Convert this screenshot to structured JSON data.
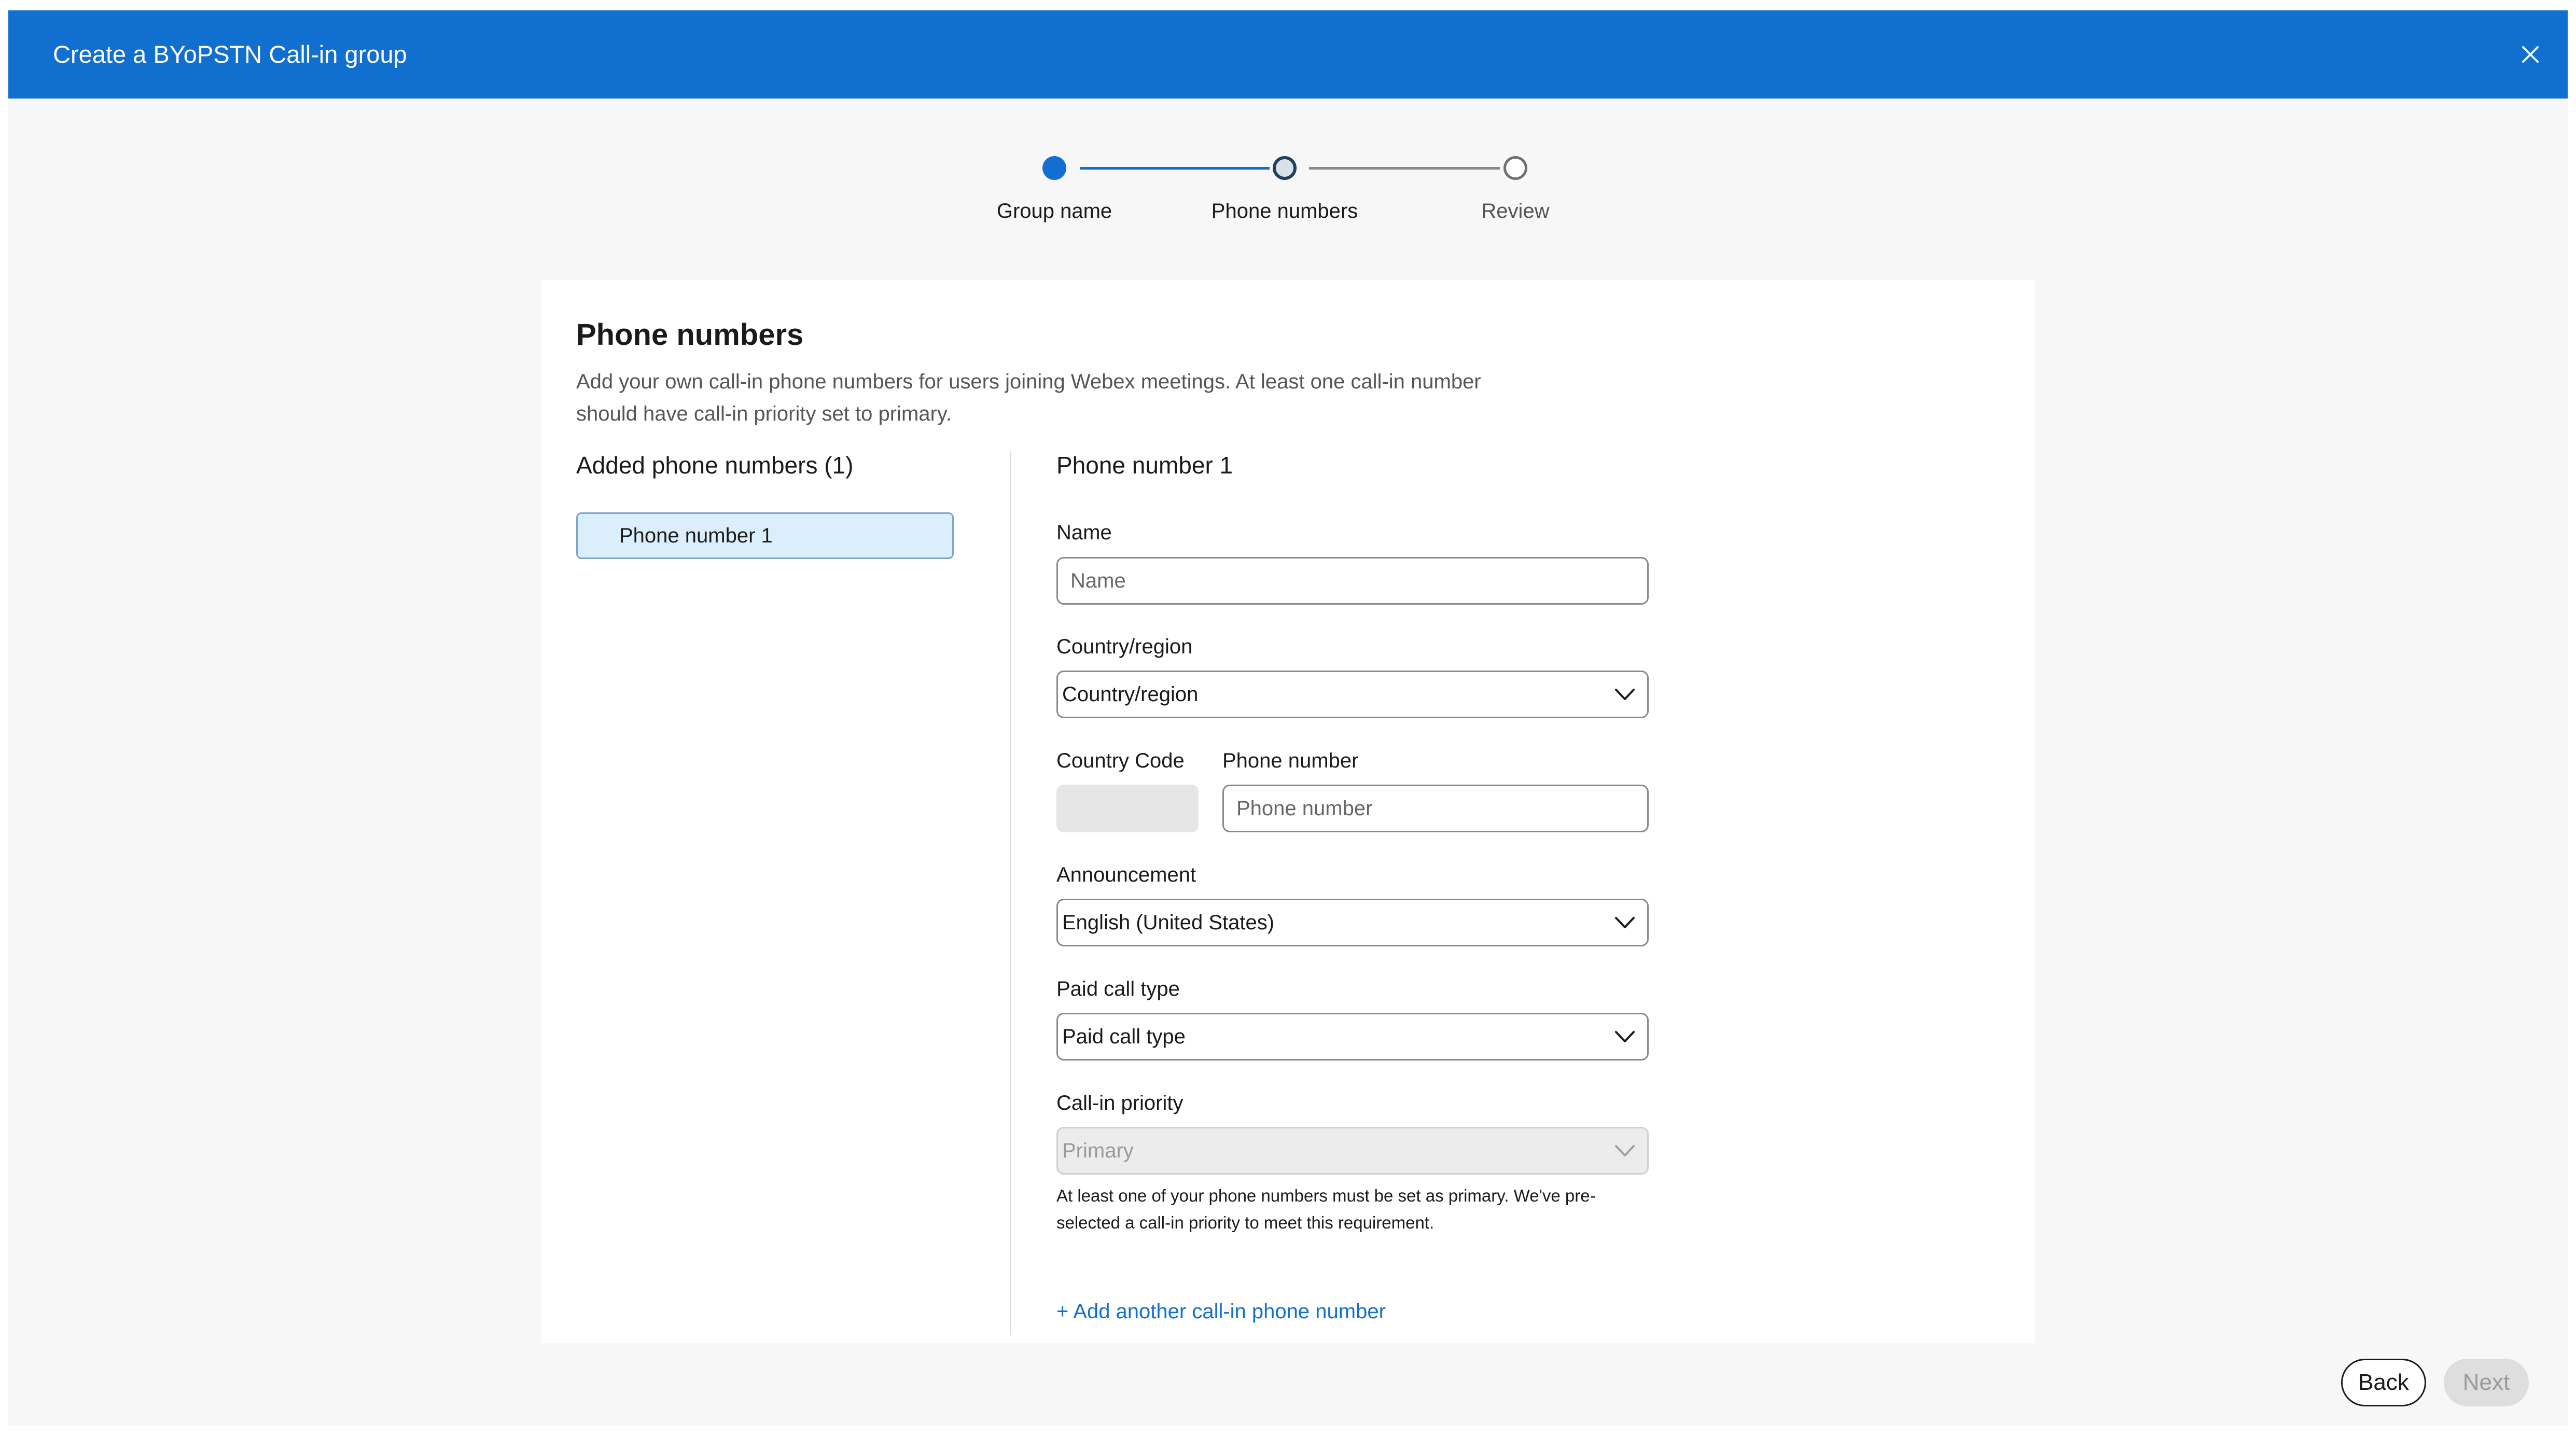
{
  "dialog": {
    "title": "Create a BYoPSTN Call-in group",
    "close_icon": "close-icon"
  },
  "stepper": {
    "steps": [
      {
        "label": "Group name",
        "state": "complete"
      },
      {
        "label": "Phone numbers",
        "state": "current"
      },
      {
        "label": "Review",
        "state": "upcoming"
      }
    ]
  },
  "content": {
    "heading": "Phone numbers",
    "description": "Add your own call-in phone numbers for users joining Webex meetings. At least one call-in number should have call-in priority set to primary.",
    "added_heading": "Added phone numbers (1)",
    "added_items": [
      "Phone number 1"
    ]
  },
  "form": {
    "section_title": "Phone number 1",
    "name_label": "Name",
    "name_placeholder": "Name",
    "country_label": "Country/region",
    "country_value": "Country/region",
    "country_code_label": "Country Code",
    "phone_label": "Phone number",
    "phone_placeholder": "Phone number",
    "announcement_label": "Announcement",
    "announcement_value": "English (United States)",
    "paid_label": "Paid call type",
    "paid_value": "Paid call type",
    "priority_label": "Call-in priority",
    "priority_value": "Primary",
    "priority_helper": "At least one of your phone numbers must be set as primary. We've pre-selected a call-in priority to meet this requirement.",
    "add_link": "+ Add another call-in phone number"
  },
  "footer": {
    "back_label": "Back",
    "next_label": "Next"
  },
  "colors": {
    "accent": "#1170cf",
    "selected_item_bg": "#dbeefc"
  }
}
